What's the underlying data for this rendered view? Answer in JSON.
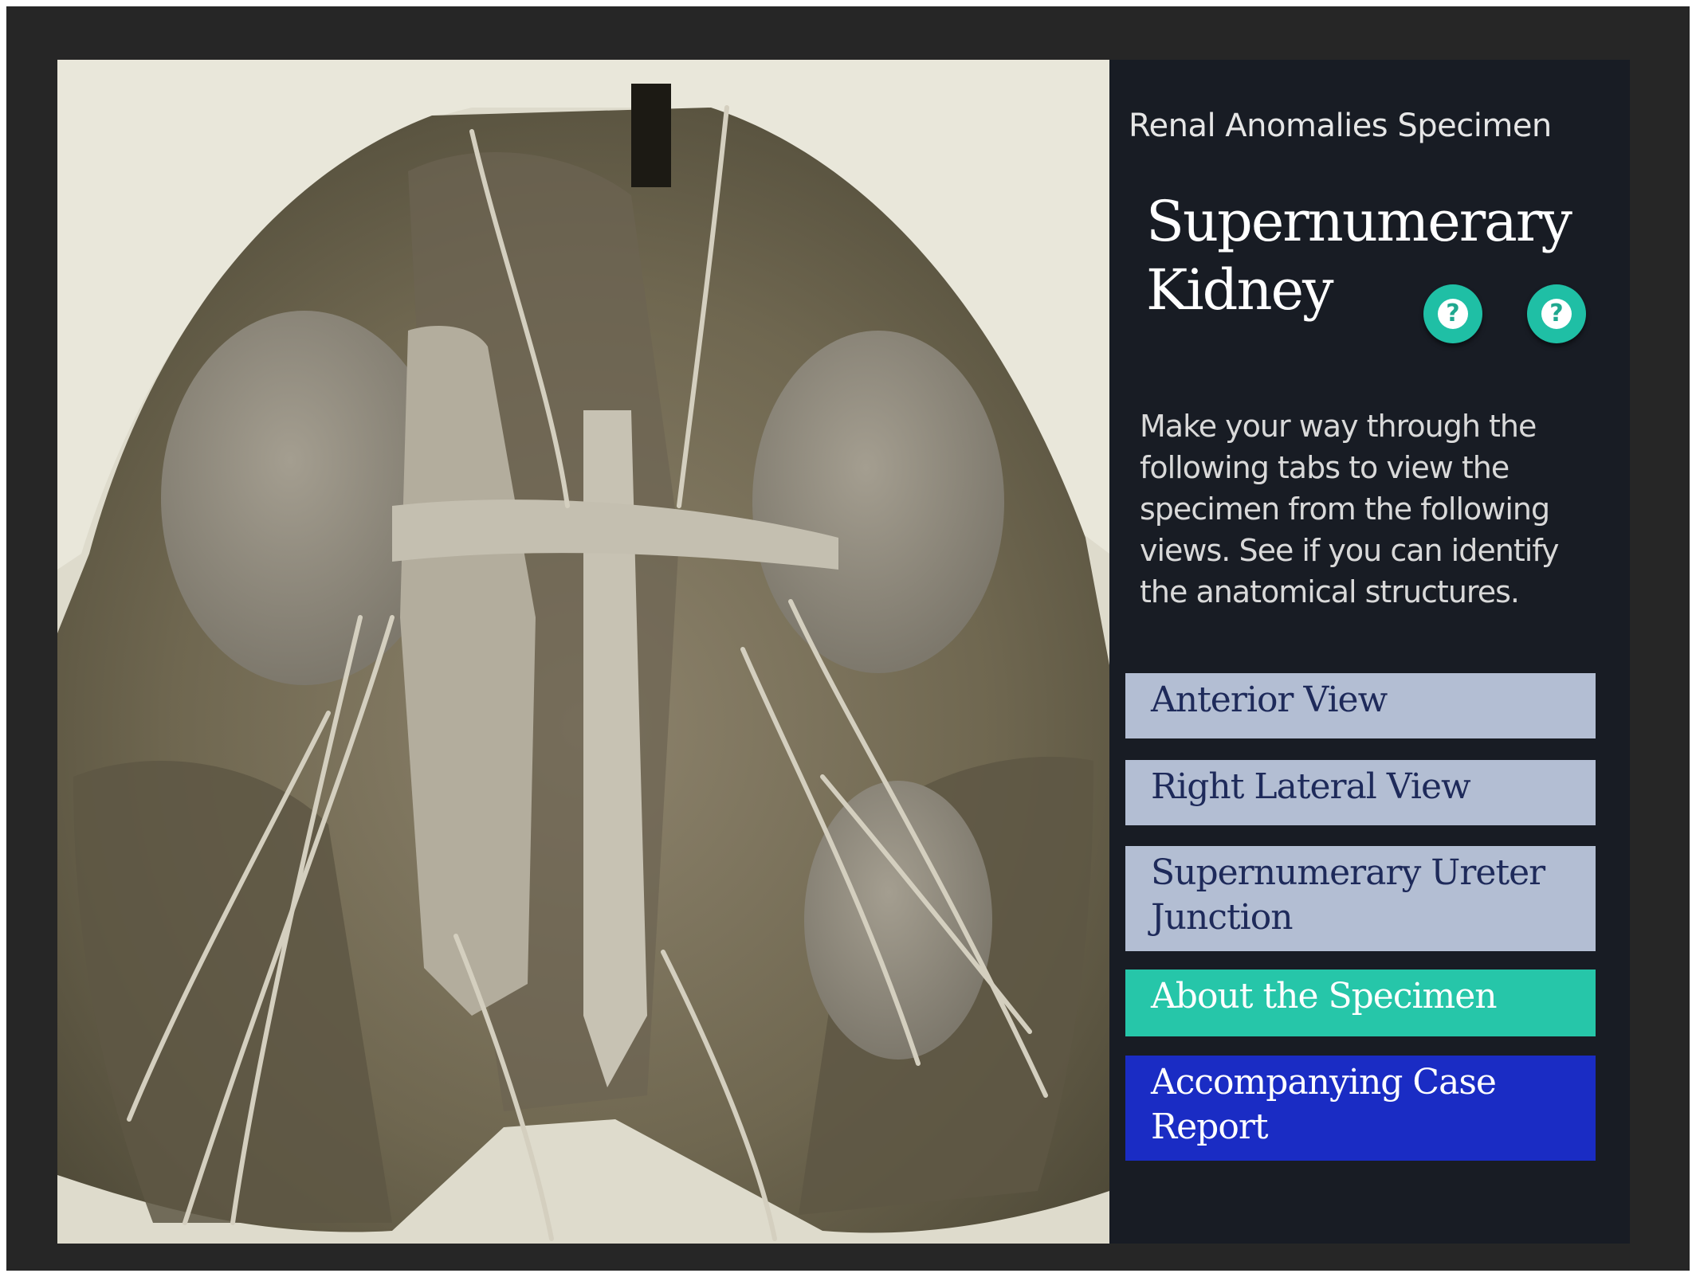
{
  "panel": {
    "subtitle": "Renal Anomalies Specimen",
    "title": "Supernumerary Kidney",
    "help_buttons": [
      {
        "icon": "help-icon",
        "glyph": "?"
      },
      {
        "icon": "help-icon",
        "glyph": "?"
      }
    ],
    "intro": "Make your way through the following tabs to view the specimen from the following views. See if you can identify the anatomical structures.",
    "tabs": [
      {
        "label": "Anterior View"
      },
      {
        "label": "Right Lateral View"
      },
      {
        "label": "Supernumerary Ureter Junction"
      },
      {
        "label": "About the Specimen"
      },
      {
        "label": "Accompanying Case Report"
      }
    ]
  },
  "colors": {
    "panel_bg": "#181c24",
    "help_accent": "#1fbfa5",
    "tab_light": "#b3bed3",
    "tab_active": "#26c6a9",
    "tab_case_report": "#1a2cc4"
  }
}
